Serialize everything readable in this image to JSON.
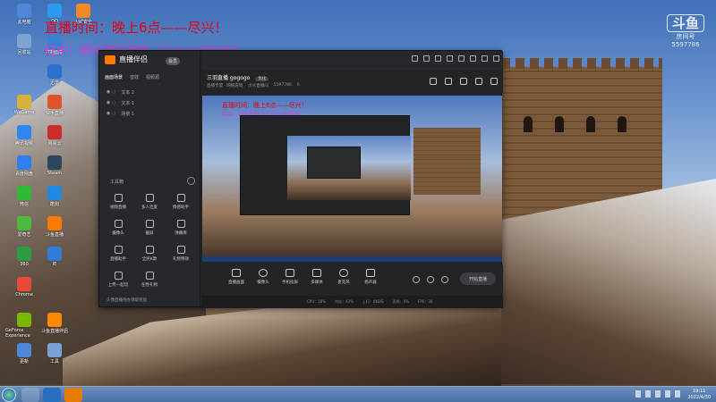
{
  "overlay": {
    "line1": "直播时间：晚上6点——尽兴！",
    "line2": "红中：陪玩陪玩陪聊 +V mysl66666"
  },
  "brand": {
    "mark": "斗鱼",
    "sub": "房间号",
    "room_id": "5597786"
  },
  "desktop_icons": [
    {
      "label": "此电脑",
      "color": "#4d87d6"
    },
    {
      "label": "QQ",
      "color": "#2b9af0"
    },
    {
      "label": "火绒安全",
      "color": "#f08a24"
    },
    {
      "label": "回收站",
      "color": "#7fa3d2"
    },
    {
      "label": "控制面板",
      "color": "#3a7fd0"
    },
    {
      "label": "迅雷",
      "color": "#2e6fd0"
    },
    {
      "label": "WeGame",
      "color": "#d9b03a"
    },
    {
      "label": "快手直播",
      "color": "#e0542a"
    },
    {
      "label": "腾讯视频",
      "color": "#2f86f0"
    },
    {
      "label": "网易云",
      "color": "#cc2c2c"
    },
    {
      "label": "百度网盘",
      "color": "#2d7ff0"
    },
    {
      "label": "Steam",
      "color": "#2a475e"
    },
    {
      "label": "微信",
      "color": "#2dbb38"
    },
    {
      "label": "酷狗",
      "color": "#1e88e5"
    },
    {
      "label": "爱奇艺",
      "color": "#4fb83e"
    },
    {
      "label": "斗鱼直播",
      "color": "#ff7a00"
    },
    {
      "label": "360",
      "color": "#2f9c3f"
    },
    {
      "label": "IE",
      "color": "#2f7ed8"
    },
    {
      "label": "Chrome",
      "color": "#e84a3a"
    },
    {
      "label": "GeForce Experience",
      "color": "#76b900"
    },
    {
      "label": "斗鱼直播伴侣",
      "color": "#ff8a00"
    },
    {
      "label": "更新",
      "color": "#4d87d6"
    },
    {
      "label": "工具",
      "color": "#7aa2d6"
    }
  ],
  "app": {
    "title": "直播伴侣",
    "badge": "会员",
    "side_tabs": [
      "画面场景",
      "音效",
      "视频源"
    ],
    "scenes": [
      "文本 2",
      "文本 1",
      "场景 1"
    ],
    "toolbox_title": "工具箱",
    "tools": [
      {
        "label": "视频直播"
      },
      {
        "label": "多人连麦"
      },
      {
        "label": "情感助手"
      },
      {
        "label": "摄像头"
      },
      {
        "label": "截屏"
      },
      {
        "label": "弹幕库"
      },
      {
        "label": "直播助手"
      },
      {
        "label": "全民K歌"
      },
      {
        "label": "礼物特效"
      },
      {
        "label": "上传一起玩"
      },
      {
        "label": "任性礼物"
      }
    ],
    "side_footer": "头像直播待办领取奖励",
    "room_title": "三羽直播 gogogo",
    "room_tag": "优化",
    "room_meta": [
      "直播卡盟 · 网络游戏",
      "大众直播间",
      "5597786",
      "6"
    ],
    "controls": [
      {
        "label": "直播画面"
      },
      {
        "label": "摄像头"
      },
      {
        "label": "手机投屏"
      },
      {
        "label": "多媒体"
      },
      {
        "label": "麦克风"
      },
      {
        "label": "扬声器"
      }
    ],
    "start_label": "开始直播",
    "status": [
      "CPU：18%",
      "内存：43%",
      "上行：0KB/S",
      "丢帧：0%",
      "FPS：30"
    ]
  },
  "preview": {
    "line1": "直播时间：晚上6点——尽兴！",
    "line2": "红中：陪玩陪聊 +V mysl66666"
  },
  "taskbar": {
    "clock_time": "19:11",
    "clock_date": "2022/4/30"
  }
}
